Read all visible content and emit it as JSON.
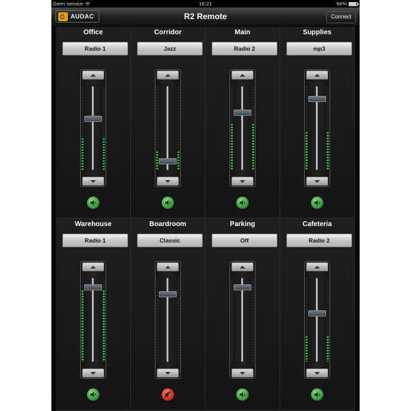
{
  "status_bar": {
    "carrier": "Geen service",
    "time": "16:21",
    "battery_text": "94%",
    "battery_level": 0.94
  },
  "nav_bar": {
    "logo_text": "AUDAC",
    "title": "R2 Remote",
    "connect_label": "Connect"
  },
  "colors": {
    "accent_yellow": "#e0a400",
    "meter_green": "#2fbf2f",
    "unmuted_green": "#3aa83a",
    "muted_red": "#d4261c"
  },
  "icons": {
    "speaker": "speaker-icon",
    "speaker_muted": "speaker-muted-icon",
    "up": "arrow-up-icon",
    "down": "arrow-down-icon"
  },
  "zones": [
    {
      "name": "Office",
      "source": "Radio 1",
      "volume": 0.62,
      "meter": 0.38,
      "muted": false
    },
    {
      "name": "Corridor",
      "source": "Jazz",
      "volume": 0.07,
      "meter": 0.22,
      "muted": false
    },
    {
      "name": "Main",
      "source": "Radio 2",
      "volume": 0.7,
      "meter": 0.55,
      "muted": false
    },
    {
      "name": "Supplies",
      "source": "mp3",
      "volume": 0.88,
      "meter": 0.45,
      "muted": false
    },
    {
      "name": "Warehouse",
      "source": "Radio 1",
      "volume": 0.92,
      "meter": 0.85,
      "muted": false
    },
    {
      "name": "Boardroom",
      "source": "Classic",
      "volume": 0.83,
      "meter": 0.0,
      "muted": true
    },
    {
      "name": "Parking",
      "source": "Off",
      "volume": 0.92,
      "meter": 0.0,
      "muted": false
    },
    {
      "name": "Cafeteria",
      "source": "Radio 2",
      "volume": 0.58,
      "meter": 0.3,
      "muted": false
    }
  ]
}
